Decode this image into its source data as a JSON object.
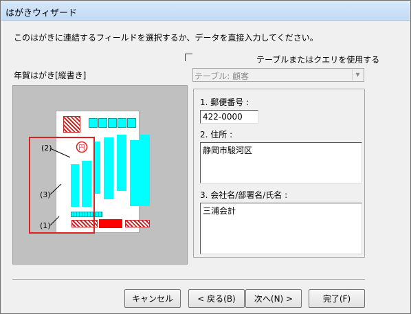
{
  "window": {
    "title": "はがきウィザード"
  },
  "instruction": "このはがきに連結するフィールドを選択するか、データを直接入力してください。",
  "use_table_checkbox": {
    "checked": false,
    "label": "テーブルまたはクエリを使用する"
  },
  "preview": {
    "label": "年賀はがき[縦書き]",
    "annotations": [
      "(2)",
      "(3)",
      "(1)"
    ],
    "colors": {
      "accent_red": "#ff0000",
      "field_cyan": "#00ffff",
      "hatch_red": "#c4292a"
    }
  },
  "table_dropdown": {
    "value": "テーブル: 顧客",
    "enabled": false
  },
  "fields": {
    "postal": {
      "label": "1. 郵便番号 :",
      "value": "422-0000"
    },
    "address": {
      "label": "2. 住所 :",
      "value": "静岡市駿河区"
    },
    "name": {
      "label": "3. 会社名/部署名/氏名 :",
      "value": "三浦会計"
    }
  },
  "buttons": {
    "cancel": "キャンセル",
    "back": "< 戻る(B)",
    "next": "次へ(N) >",
    "finish": "完了(F)"
  }
}
